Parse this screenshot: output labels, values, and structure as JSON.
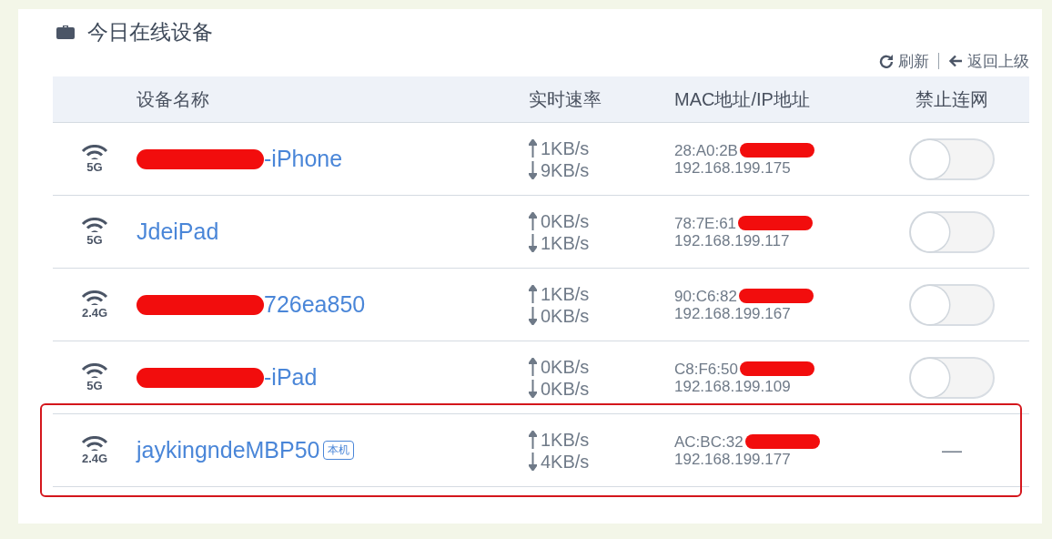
{
  "title": "今日在线设备",
  "actions": [
    {
      "kind": "refresh",
      "label": "刷新"
    },
    {
      "kind": "back",
      "label": "返回上级"
    }
  ],
  "table": {
    "columns": [
      "设备名称",
      "实时速率",
      "MAC地址/IP地址",
      "禁止连网"
    ],
    "rows": [
      {
        "band": "5G",
        "name": "-iPhone",
        "name_redacted": true,
        "up": "1KB/s",
        "down": "9KB/s",
        "mac": "28:A0:2B",
        "mac_redacted": true,
        "ip": "192.168.199.175",
        "highlighted": false,
        "block": {
          "kind": "toggle",
          "on": false
        }
      },
      {
        "band": "5G",
        "name": "JdeiPad",
        "name_redacted": false,
        "up": "0KB/s",
        "down": "1KB/s",
        "mac": "78:7E:61",
        "mac_redacted": true,
        "ip": "192.168.199.117",
        "highlighted": false,
        "block": {
          "kind": "toggle",
          "on": false
        }
      },
      {
        "band": "2.4G",
        "name": "726ea850",
        "name_redacted": true,
        "up": "1KB/s",
        "down": "0KB/s",
        "mac": "90:C6:82",
        "mac_redacted": true,
        "ip": "192.168.199.167",
        "highlighted": false,
        "block": {
          "kind": "toggle",
          "on": false
        }
      },
      {
        "band": "5G",
        "name": "-iPad",
        "name_redacted": true,
        "up": "0KB/s",
        "down": "0KB/s",
        "mac": "C8:F6:50",
        "mac_redacted": true,
        "ip": "192.168.199.109",
        "highlighted": false,
        "block": {
          "kind": "toggle",
          "on": false
        }
      },
      {
        "band": "2.4G",
        "name": "jaykingndeMBP50",
        "name_redacted": false,
        "badge": "本机",
        "up": "1KB/s",
        "down": "4KB/s",
        "mac": "AC:BC:32",
        "mac_redacted": true,
        "ip": "192.168.199.177",
        "highlighted": true,
        "block": {
          "kind": "text",
          "text": "—"
        }
      }
    ]
  }
}
